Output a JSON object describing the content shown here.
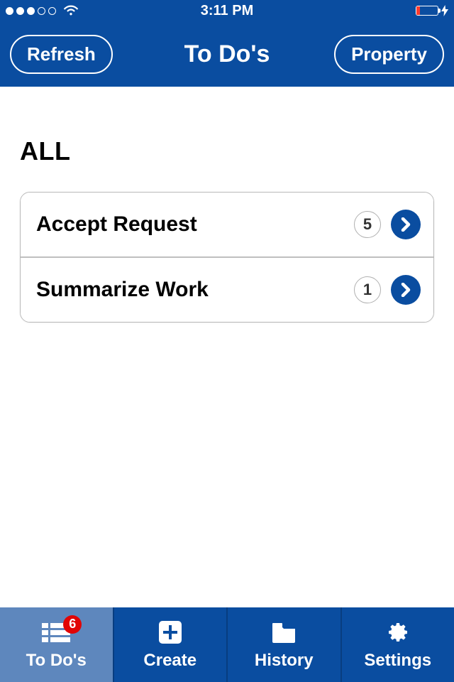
{
  "status": {
    "time": "3:11 PM"
  },
  "nav": {
    "left_label": "Refresh",
    "title": "To Do's",
    "right_label": "Property"
  },
  "section_title": "ALL",
  "items": [
    {
      "label": "Accept Request",
      "count": "5"
    },
    {
      "label": "Summarize Work",
      "count": "1"
    }
  ],
  "tabs": {
    "todos": {
      "label": "To Do's",
      "badge": "6"
    },
    "create": {
      "label": "Create"
    },
    "history": {
      "label": "History"
    },
    "settings": {
      "label": "Settings"
    }
  }
}
